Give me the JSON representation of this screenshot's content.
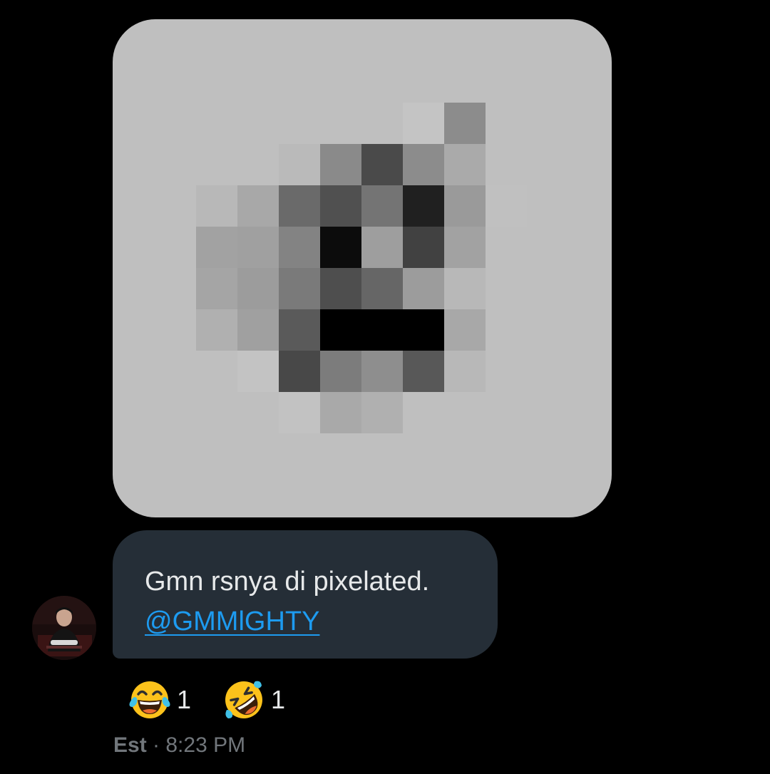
{
  "message": {
    "text": "Gmn rsnya di pixelated.",
    "mention": "@GMMlGHTY"
  },
  "reactions": [
    {
      "emoji": "face-with-tears-of-joy",
      "count": "1"
    },
    {
      "emoji": "rolling-on-the-floor-laughing",
      "count": "1"
    }
  ],
  "meta": {
    "status": "Est",
    "separator": " · ",
    "time": "8:23 PM"
  },
  "colors": {
    "background": "#000000",
    "bubble": "#252e37",
    "mention": "#1d9bf0",
    "meta": "#71767b"
  }
}
